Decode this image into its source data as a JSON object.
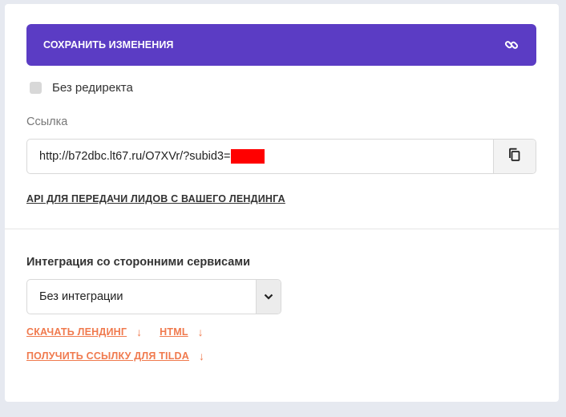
{
  "save_button": {
    "label": "СОХРАНИТЬ ИЗМЕНЕНИЯ",
    "icon": "link-icon"
  },
  "redirect": {
    "label": "Без редиректа",
    "checked": false
  },
  "link_field": {
    "label": "Ссылка",
    "value": "http://b72dbc.lt67.ru/O7XVr/?subid3=",
    "copy_icon": "copy-icon"
  },
  "api_link": "API ДЛЯ ПЕРЕДАЧИ ЛИДОВ С ВАШЕГО ЛЕНДИНГА",
  "integration": {
    "title": "Интеграция со сторонними сервисами",
    "selected": "Без интеграции"
  },
  "downloads": {
    "landing": "СКАЧАТЬ ЛЕНДИНГ",
    "html": "HTML",
    "arrow": "↓",
    "tilda": "ПОЛУЧИТЬ ССЫЛКУ ДЛЯ TILDA"
  },
  "colors": {
    "accent": "#5b3cc4",
    "link_orange": "#f07a4e",
    "background": "#e6e9f0",
    "redaction": "#ff0000"
  }
}
